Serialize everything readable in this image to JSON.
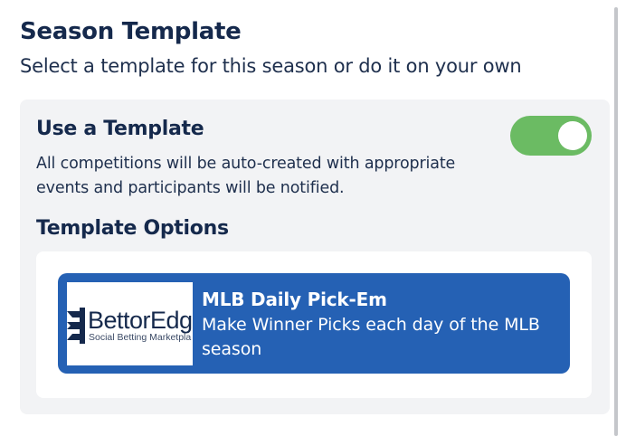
{
  "header": {
    "title": "Season Template",
    "subtitle": "Select a template for this season or do it on your own"
  },
  "use_template": {
    "title": "Use a Template",
    "description": "All competitions will be auto-created with appropriate events and participants will be notified.",
    "toggle_on": true,
    "toggle_color": "#6bbb63"
  },
  "template_options": {
    "title": "Template Options",
    "templates": [
      {
        "logo_text": "BettorEdg",
        "logo_tagline": "Social Betting Marketpla",
        "name": "MLB Daily Pick-Em",
        "description": "Make Winner Picks each day of the MLB season",
        "selected": true,
        "card_color": "#2561b4"
      }
    ]
  }
}
